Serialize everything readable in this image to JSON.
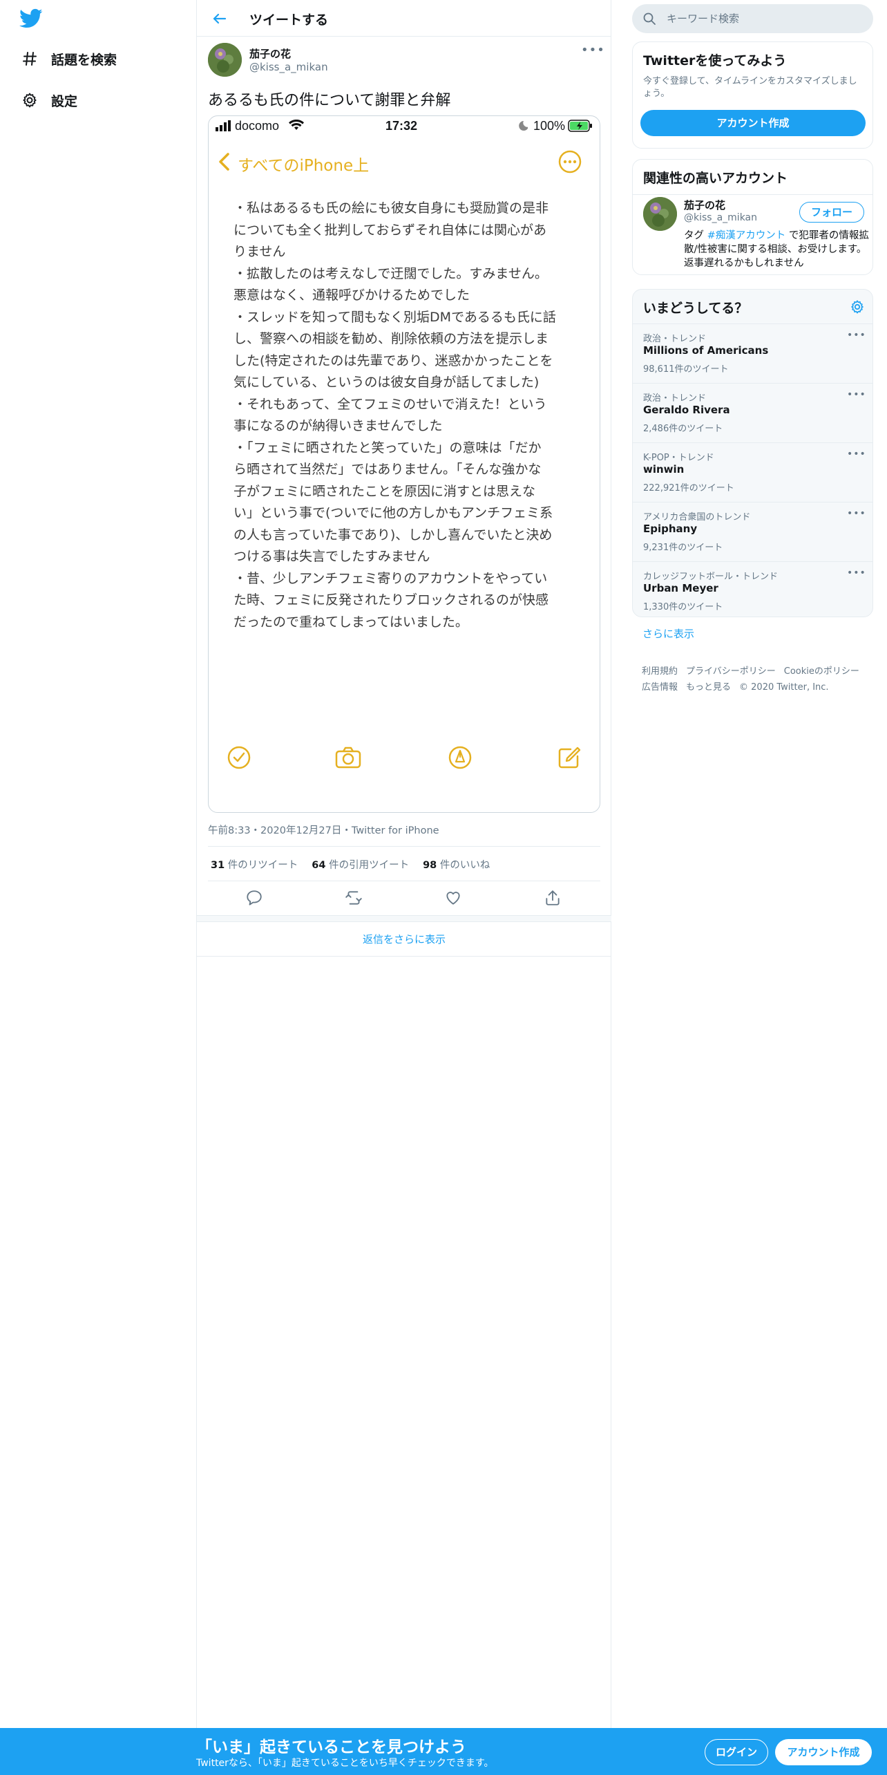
{
  "colors": {
    "brand": "#1da1f2",
    "notes_accent": "#e5b020",
    "text": "#14171a",
    "muted": "#657786"
  },
  "nav": {
    "logo_icon": "twitter-bird-icon",
    "items": [
      {
        "icon": "hashtag-icon",
        "label": "話題を検索"
      },
      {
        "icon": "gear-icon",
        "label": "設定"
      }
    ]
  },
  "header": {
    "back_icon": "back-arrow-icon",
    "title": "ツイートする"
  },
  "tweet": {
    "name": "茄子の花",
    "handle": "@kiss_a_mikan",
    "text": "あるるも氏の件について謝罪と弁解",
    "timestamp": "午前8:33・2020年12月27日・Twitter for iPhone",
    "stats": {
      "retweets": "31",
      "retweets_label": "件のリツイート",
      "quotes": "64",
      "quotes_label": "件の引用ツイート",
      "likes": "98",
      "likes_label": "件のいいね"
    },
    "media": {
      "status": {
        "carrier": "docomo",
        "time": "17:32",
        "battery": "100%"
      },
      "back_label": "すべてのiPhone上",
      "body": "・私はあるるも氏の絵にも彼女自身にも奨励賞の是非\nについても全く批判しておらずそれ自体には関心があ\nりません\n・拡散したのは考えなしで迂闊でした。すみません。\n悪意はなく、通報呼びかけるためでした\n・スレッドを知って間もなく別垢DMであるるも氏に話\nし、警察への相談を勧め、削除依頼の方法を提示しま\nした(特定されたのは先輩であり、迷惑かかったことを\n気にしている、というのは彼女自身が話してました)\n・それもあって、全てフェミのせいで消えた！という\n事になるのが納得いきませんでした\n・「フェミに晒されたと笑っていた」の意味は「だか\nら晒されて当然だ」ではありません。「そんな強かな\n子がフェミに晒されたことを原因に消すとは思えな\nい」という事で(ついでに他の方しかもアンチフェミ系\nの人も言っていた事であり)、しかし喜んでいたと決め\nつける事は失言でしたすみません\n・昔、少しアンチフェミ寄りのアカウントをやってい\nた時、フェミに反発されたりブロックされるのが快感\nだったので重ねてしまってはいました。"
    },
    "actions": [
      "reply-icon",
      "retweet-icon",
      "like-icon",
      "share-icon"
    ]
  },
  "show_more_replies": "返信をさらに表示",
  "search": {
    "placeholder": "キーワード検索"
  },
  "signup_card": {
    "title": "Twitterを使ってみよう",
    "subtitle": "今すぐ登録して、タイムラインをカスタマイズしましょう。",
    "button": "アカウント作成"
  },
  "related": {
    "title": "関連性の高いアカウント",
    "name": "茄子の花",
    "handle": "@kiss_a_mikan",
    "follow": "フォロー",
    "bio_prefix": "タグ ",
    "bio_tag": "#痴漢アカウント",
    "bio_suffix": " で犯罪者の情報拡散/性被害に関する相談、お受けします。返事遅れるかもしれません"
  },
  "trends": {
    "title": "いまどうしてる？",
    "items": [
      {
        "context": "政治・トレンド",
        "name": "Millions of Americans",
        "count": "98,611件のツイート"
      },
      {
        "context": "政治・トレンド",
        "name": "Geraldo Rivera",
        "count": "2,486件のツイート"
      },
      {
        "context": "K-POP・トレンド",
        "name": "winwin",
        "count": "222,921件のツイート"
      },
      {
        "context": "アメリカ合衆国のトレンド",
        "name": "Epiphany",
        "count": "9,231件のツイート"
      },
      {
        "context": "カレッジフットボール・トレンド",
        "name": "Urban Meyer",
        "count": "1,330件のツイート"
      }
    ],
    "show_more": "さらに表示"
  },
  "footer": {
    "terms": "利用規約",
    "privacy": "プライバシーポリシー",
    "cookies": "Cookieのポリシー",
    "ads": "広告情報",
    "more": "もっと見る",
    "copyright": "© 2020 Twitter, Inc."
  },
  "bottom_bar": {
    "title": "「いま」起きていることを見つけよう",
    "subtitle": "Twitterなら、「いま」起きていることをいち早くチェックできます。",
    "login": "ログイン",
    "signup": "アカウント作成"
  }
}
